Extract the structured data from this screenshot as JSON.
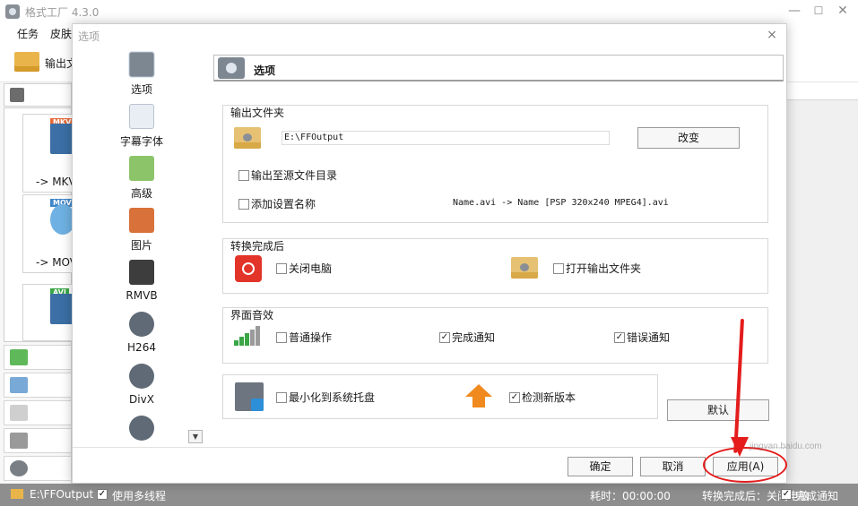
{
  "app": {
    "title": "格式工厂 4.3.0",
    "window_controls": [
      "—",
      "☐",
      "✕"
    ],
    "menu": [
      "任务",
      "皮肤"
    ],
    "toolbar_output_label": "输出文",
    "left_list": [
      "-> MKV",
      "-> MOV",
      ""
    ],
    "left_badges": [
      "MKV",
      "MOV",
      "AVI"
    ],
    "right_partial_button": "默认"
  },
  "status_bar": {
    "output_path": "E:\\FFOutput",
    "multithread_checked": true,
    "multithread_label": "使用多线程",
    "elapsed": "耗时：00:00:00",
    "after_convert": "转换完成后：关闭电脑",
    "notify_checked": true,
    "notify_label": "完成通知"
  },
  "dialog": {
    "title": "选项",
    "close_glyph": "×",
    "sidebar": [
      {
        "label": "选项",
        "icon": "options-icon",
        "active": true
      },
      {
        "label": "字幕字体",
        "icon": "subtitle-font-icon",
        "active": false
      },
      {
        "label": "高级",
        "icon": "advanced-icon",
        "active": false
      },
      {
        "label": "图片",
        "icon": "picture-icon",
        "active": false
      },
      {
        "label": "RMVB",
        "icon": "rmvb-icon",
        "active": false
      },
      {
        "label": "H264",
        "icon": "h264-icon",
        "active": false
      },
      {
        "label": "DivX",
        "icon": "divx-icon",
        "active": false
      },
      {
        "label": "",
        "icon": "film-icon",
        "active": false
      }
    ],
    "panel_title": "选项",
    "output_folder": {
      "group_title": "输出文件夹",
      "path": "E:\\FFOutput",
      "change_button": "改变",
      "to_source_dir_label": "输出至源文件目录",
      "to_source_dir_checked": false,
      "add_setting_name_label": "添加设置名称",
      "add_setting_name_checked": false,
      "name_example": "Name.avi  -> Name [PSP 320x240 MPEG4].avi"
    },
    "after_convert": {
      "group_title": "转换完成后",
      "shutdown_label": "关闭电脑",
      "shutdown_checked": false,
      "open_folder_label": "打开输出文件夹",
      "open_folder_checked": false
    },
    "ui_sound": {
      "group_title": "界面音效",
      "normal_label": "普通操作",
      "normal_checked": false,
      "done_label": "完成通知",
      "done_checked": true,
      "error_label": "错误通知",
      "error_checked": true
    },
    "misc": {
      "minimize_tray_label": "最小化到系统托盘",
      "minimize_tray_checked": false,
      "check_update_label": "检测新版本",
      "check_update_checked": true
    },
    "buttons": {
      "ok": "确定",
      "cancel": "取消",
      "apply": "应用(A)",
      "default": "默认"
    }
  },
  "watermark": "jingyan.baidu.com",
  "check_glyph": "✓",
  "colors": {
    "annotation": "#e41c1c",
    "statusbar": "#8e8e8e",
    "power": "#e3342a",
    "update": "#f08a1e",
    "sound": "#3aa646"
  }
}
